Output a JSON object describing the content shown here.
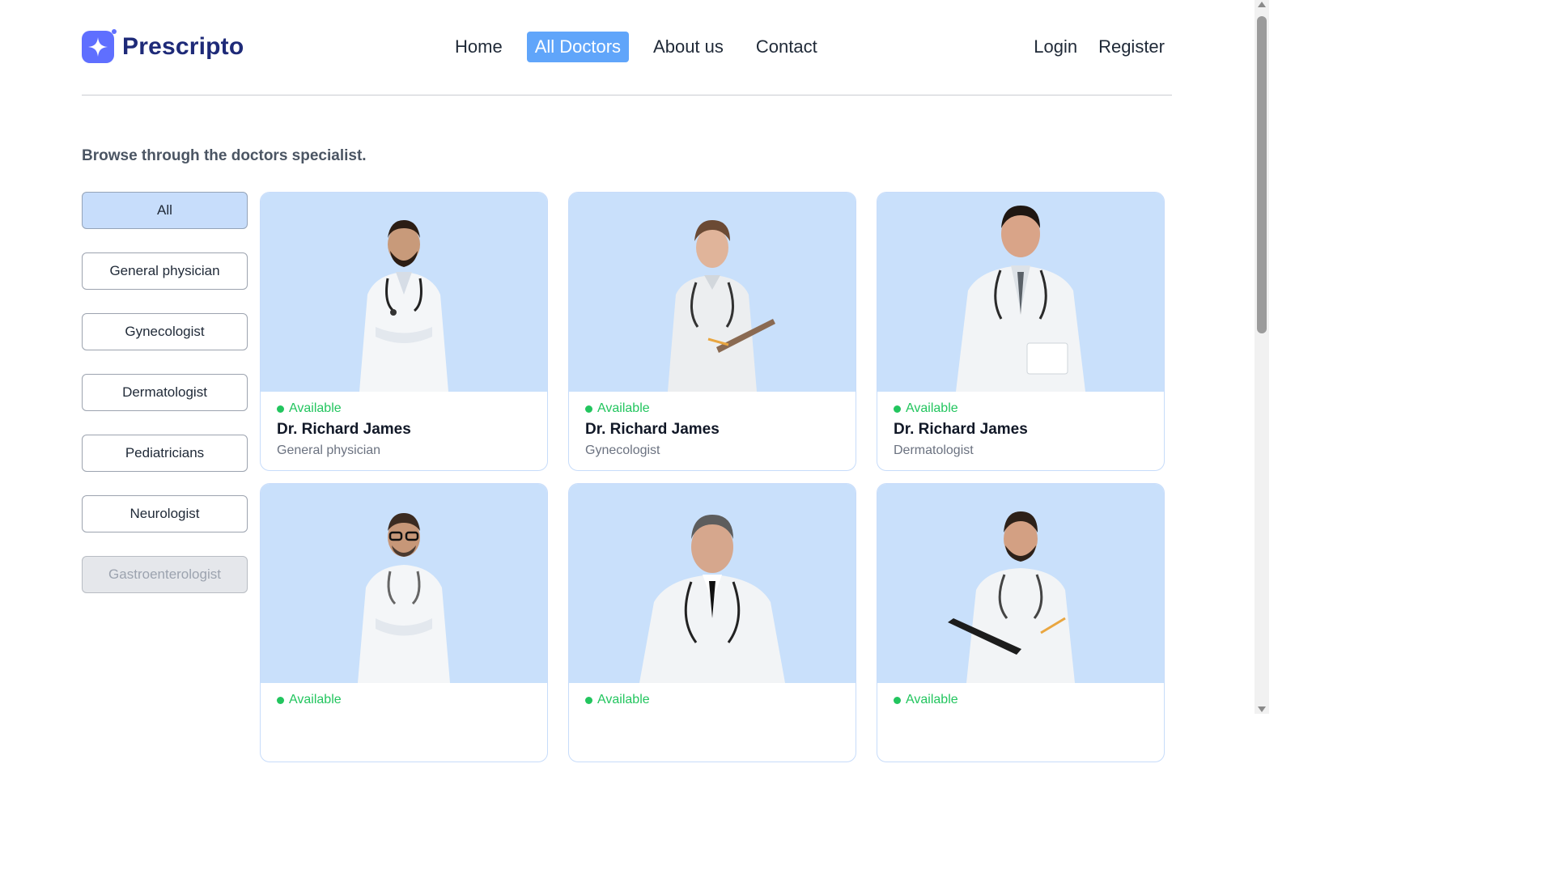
{
  "brand": {
    "name": "Prescripto",
    "accent": "#5f6fff"
  },
  "nav": {
    "items": [
      {
        "label": "Home",
        "active": false
      },
      {
        "label": "All Doctors",
        "active": true
      },
      {
        "label": "About us",
        "active": false
      },
      {
        "label": "Contact",
        "active": false
      }
    ],
    "login": "Login",
    "register": "Register"
  },
  "page": {
    "title": "Browse through the doctors specialist."
  },
  "filters": [
    {
      "label": "All",
      "state": "active"
    },
    {
      "label": "General physician",
      "state": "normal"
    },
    {
      "label": "Gynecologist",
      "state": "normal"
    },
    {
      "label": "Dermatologist",
      "state": "normal"
    },
    {
      "label": "Pediatricians",
      "state": "normal"
    },
    {
      "label": "Neurologist",
      "state": "normal"
    },
    {
      "label": "Gastroenterologist",
      "state": "disabled"
    }
  ],
  "doctors": [
    {
      "status": "Available",
      "name": "Dr. Richard James",
      "speciality": "General physician"
    },
    {
      "status": "Available",
      "name": "Dr. Richard James",
      "speciality": "Gynecologist"
    },
    {
      "status": "Available",
      "name": "Dr. Richard James",
      "speciality": "Dermatologist"
    },
    {
      "status": "Available",
      "name": "",
      "speciality": ""
    },
    {
      "status": "Available",
      "name": "",
      "speciality": ""
    },
    {
      "status": "Available",
      "name": "",
      "speciality": ""
    }
  ],
  "colors": {
    "available": "#22c55e",
    "card_bg": "#c9e0fb",
    "active_nav": "#60a5fa"
  }
}
